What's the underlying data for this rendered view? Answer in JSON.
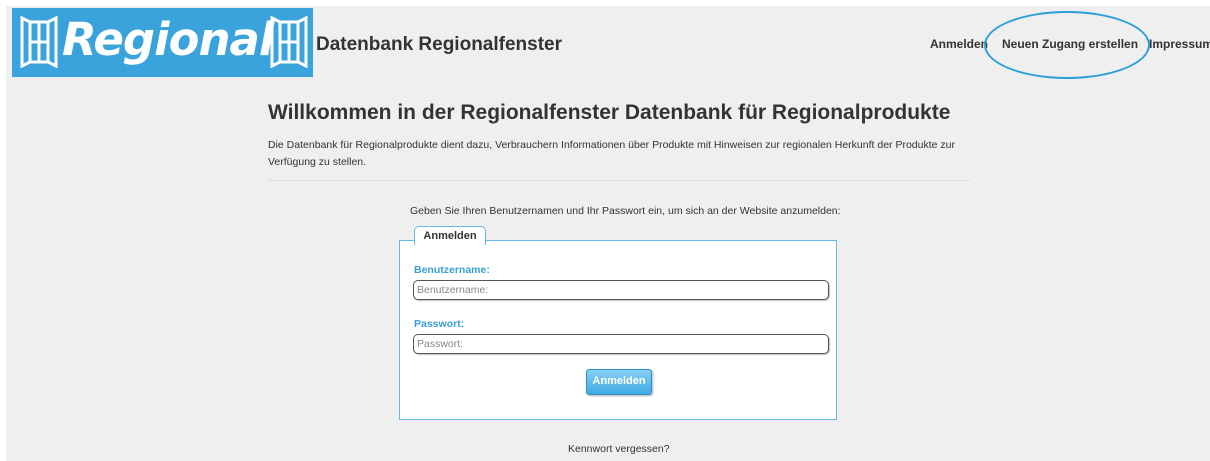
{
  "header": {
    "logo_text": "Regional",
    "site_title": "Datenbank Regionalfenster"
  },
  "nav": {
    "login": "Anmelden",
    "register": "Neuen Zugang erstellen",
    "imprint": "Impressum"
  },
  "main": {
    "title": "Willkommen in der Regionalfenster Datenbank für Regionalprodukte",
    "intro": "Die Datenbank für Regionalprodukte dient dazu, Verbrauchern Informationen über Produkte mit Hinweisen zur regionalen Herkunft der Produkte zur Verfügung zu stellen.",
    "login_prompt": "Geben Sie Ihren Benutzernamen und Ihr Passwort ein, um sich an der Website anzumelden:"
  },
  "login_form": {
    "tab_label": "Anmelden",
    "username_label": "Benutzername:",
    "username_placeholder": "Benutzername:",
    "username_value": "",
    "password_label": "Passwort:",
    "password_placeholder": "Passwort:",
    "password_value": "",
    "submit_label": "Anmelden",
    "forgot_link": "Kennwort vergessen?"
  },
  "colors": {
    "brand_blue": "#3aa3dc",
    "label_blue": "#3a9fd6",
    "highlight_ring": "#2b9fd8",
    "page_background": "#efefef"
  },
  "icons": {
    "logo_left": "window-icon",
    "logo_right": "window-icon"
  }
}
